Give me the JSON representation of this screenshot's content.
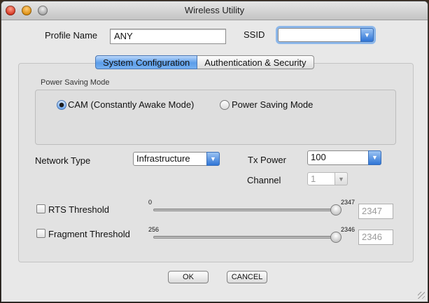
{
  "window": {
    "title": "Wireless Utility"
  },
  "profile": {
    "label": "Profile Name",
    "value": "ANY"
  },
  "ssid": {
    "label": "SSID",
    "value": ""
  },
  "tabs": [
    {
      "label": "System Configuration",
      "active": true
    },
    {
      "label": "Authentication & Security",
      "active": false
    }
  ],
  "power_saving": {
    "title": "Power Saving Mode",
    "options": [
      {
        "label": "CAM (Constantly Awake Mode)",
        "selected": true
      },
      {
        "label": "Power Saving Mode",
        "selected": false
      }
    ]
  },
  "network_type": {
    "label": "Network Type",
    "value": "Infrastructure"
  },
  "tx_power": {
    "label": "Tx Power",
    "value": "100"
  },
  "channel": {
    "label": "Channel",
    "value": "1"
  },
  "rts": {
    "label": "RTS Threshold",
    "checked": false,
    "min": "0",
    "max": "2347",
    "value": "2347"
  },
  "fragment": {
    "label": "Fragment Threshold",
    "checked": false,
    "min": "256",
    "max": "2346",
    "value": "2346"
  },
  "buttons": {
    "ok": "OK",
    "cancel": "CANCEL"
  },
  "colors": {
    "accent": "#5b9de9",
    "focus_ring": "#8cb7ea"
  }
}
